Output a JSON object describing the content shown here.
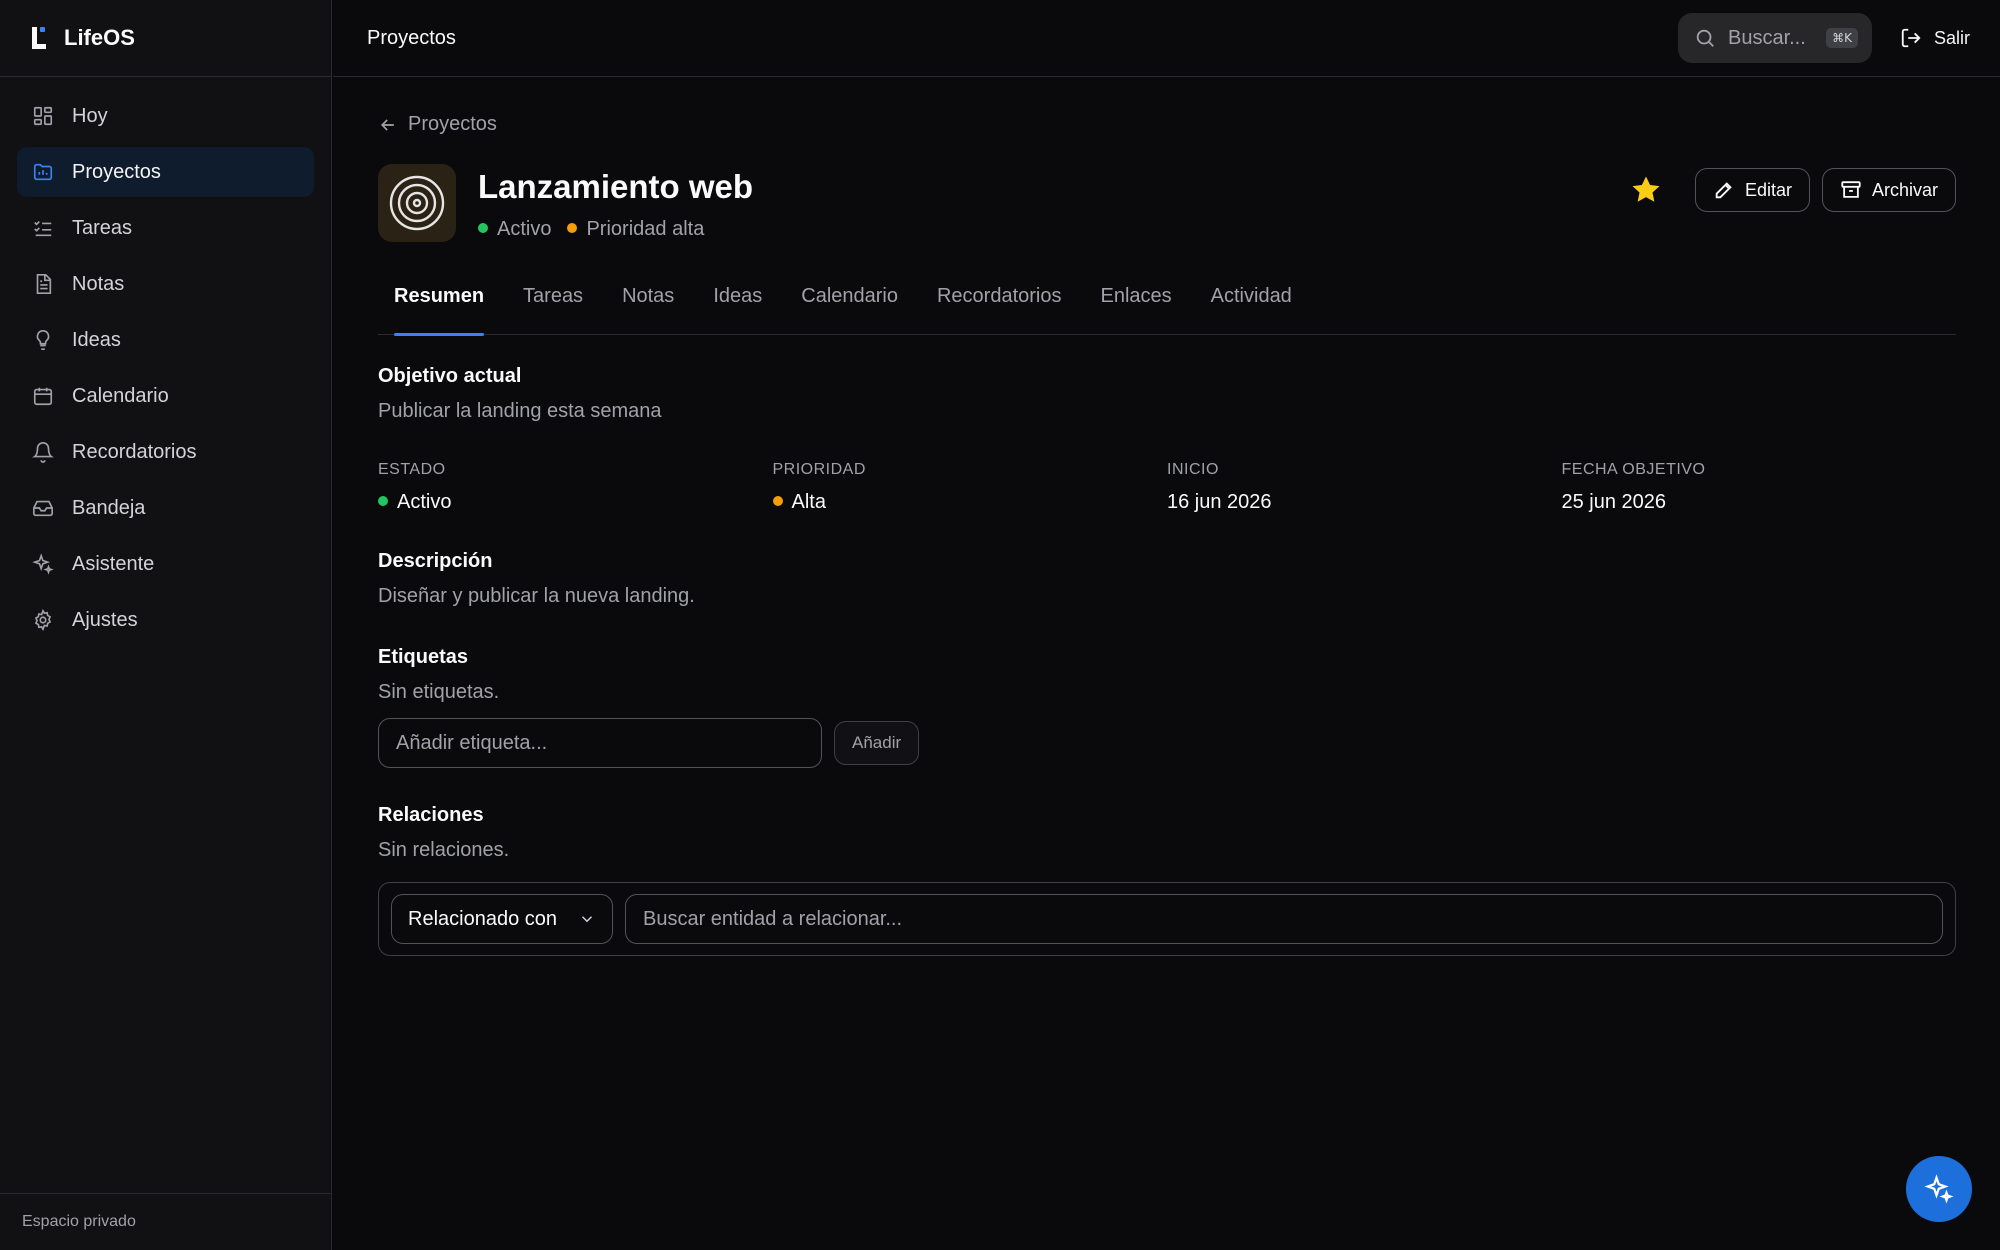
{
  "app": {
    "name": "LifeOS",
    "footer": "Espacio privado"
  },
  "sidebar": {
    "items": [
      {
        "label": "Hoy",
        "icon": "dashboard-icon"
      },
      {
        "label": "Proyectos",
        "icon": "folder-icon",
        "active": true
      },
      {
        "label": "Tareas",
        "icon": "tasks-icon"
      },
      {
        "label": "Notas",
        "icon": "note-icon"
      },
      {
        "label": "Ideas",
        "icon": "lightbulb-icon"
      },
      {
        "label": "Calendario",
        "icon": "calendar-icon"
      },
      {
        "label": "Recordatorios",
        "icon": "bell-icon"
      },
      {
        "label": "Bandeja",
        "icon": "inbox-icon"
      },
      {
        "label": "Asistente",
        "icon": "sparkles-icon"
      },
      {
        "label": "Ajustes",
        "icon": "gear-icon"
      }
    ]
  },
  "topbar": {
    "title": "Proyectos",
    "search_placeholder": "Buscar...",
    "search_shortcut": "⌘K",
    "logout_label": "Salir"
  },
  "project": {
    "back_label": "Proyectos",
    "title": "Lanzamiento web",
    "status": "Activo",
    "priority": "Prioridad alta",
    "edit_label": "Editar",
    "archive_label": "Archivar",
    "tabs": [
      "Resumen",
      "Tareas",
      "Notas",
      "Ideas",
      "Calendario",
      "Recordatorios",
      "Enlaces",
      "Actividad"
    ],
    "active_tab": "Resumen"
  },
  "summary": {
    "objective_heading": "Objetivo actual",
    "objective_text": "Publicar la landing esta semana",
    "fields": {
      "estado_label": "ESTADO",
      "estado_value": "Activo",
      "prioridad_label": "PRIORIDAD",
      "prioridad_value": "Alta",
      "inicio_label": "INICIO",
      "inicio_value": "16 jun 2026",
      "objetivo_label": "FECHA OBJETIVO",
      "objetivo_value": "25 jun 2026"
    },
    "description_heading": "Descripción",
    "description_text": "Diseñar y publicar la nueva landing.",
    "tags_heading": "Etiquetas",
    "tags_empty": "Sin etiquetas.",
    "tag_placeholder": "Añadir etiqueta...",
    "tag_add_label": "Añadir",
    "relations_heading": "Relaciones",
    "relations_empty": "Sin relaciones.",
    "relation_type": "Relacionado con",
    "relation_placeholder": "Buscar entidad a relacionar..."
  },
  "colors": {
    "accent": "#3b82f6",
    "status_active": "#22c55e",
    "priority_high": "#f59e0b",
    "favorite": "#facc15",
    "fab": "#1d6fdc"
  }
}
